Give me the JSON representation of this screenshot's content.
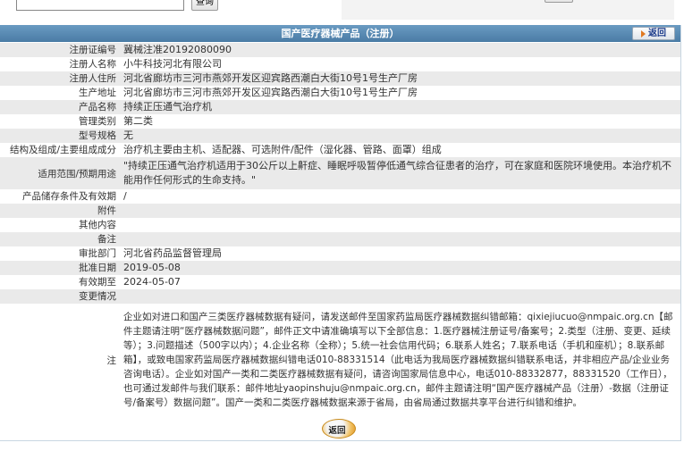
{
  "search": {
    "value": "",
    "button_label": "查询"
  },
  "header": {
    "title": "国产医疗器械产品（注册）",
    "back_label": "返回"
  },
  "fields": [
    {
      "label": "注册证编号",
      "value": "冀械注准20192080090"
    },
    {
      "label": "注册人名称",
      "value": "小牛科技河北有限公司"
    },
    {
      "label": "注册人住所",
      "value": "河北省廊坊市三河市燕郊开发区迎宾路西潮白大街10号1号生产厂房"
    },
    {
      "label": "生产地址",
      "value": "河北省廊坊市三河市燕郊开发区迎宾路西潮白大街10号1号生产厂房"
    },
    {
      "label": "产品名称",
      "value": "持续正压通气治疗机"
    },
    {
      "label": "管理类别",
      "value": "第二类"
    },
    {
      "label": "型号规格",
      "value": "无"
    },
    {
      "label": "结构及组成/主要组成成分",
      "value": "治疗机主要由主机、适配器、可选附件/配件（湿化器、管路、面罩）组成"
    },
    {
      "label": "适用范围/预期用途",
      "value": "\"持续正压通气治疗机适用于30公斤以上鼾症、睡眠呼吸暂停低通气综合征患者的治疗，可在家庭和医院环境使用。本治疗机不能用作任何形式的生命支持。\""
    },
    {
      "label": "产品储存条件及有效期",
      "value": "/"
    },
    {
      "label": "附件",
      "value": ""
    },
    {
      "label": "其他内容",
      "value": ""
    },
    {
      "label": "备注",
      "value": ""
    },
    {
      "label": "审批部门",
      "value": "河北省药品监督管理局"
    },
    {
      "label": "批准日期",
      "value": "2019-05-08"
    },
    {
      "label": "有效期至",
      "value": "2024-05-07"
    },
    {
      "label": "变更情况",
      "value": ""
    }
  ],
  "note": {
    "label": "注",
    "text": "企业如对进口和国产三类医疗器械数据有疑问，请发送邮件至国家药监局医疗器械数据纠错邮箱：qixiejiucuo@nmpaic.org.cn【邮件主题请注明“医疗器械数据问题”，邮件正文中请准确填写以下全部信息：1.医疗器械注册证号/备案号；2.类型（注册、变更、延续等）；3.问题描述（500字以内）；4.企业名称（全称）；5.统一社会信用代码；6.联系人姓名；7.联系电话（手机和座机）；8.联系邮箱】，或致电国家药监局医疗器械数据纠错电话010-88331514（此电话为我局医疗器械数据纠错联系电话，并非相应产品/企业业务咨询电话）。企业如对国产一类和二类医疗器械数据有疑问，请咨询国家局信息中心，电话010-88332877，88331520（工作日），也可通过发邮件与我们联系：邮件地址yaopinshuju@nmpaic.org.cn，邮件主题请注明“国产医疗器械产品（注册）-数据（注册证号/备案号）数据问题”。国产一类和二类医疗器械数据来源于省局，由省局通过数据共享平台进行纠错和维护。"
  },
  "footer": {
    "back_label": "返回"
  }
}
